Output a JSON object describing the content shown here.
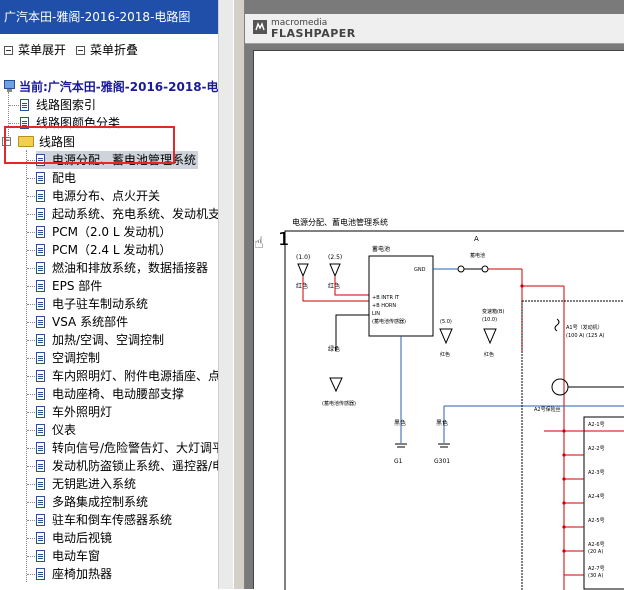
{
  "left_pane": {
    "title": "广汽本田-雅阁-2016-2018-电路图",
    "toolbar": {
      "expand": "菜单展开",
      "collapse": "菜单折叠"
    },
    "root_label": "当前:广汽本田-雅阁-2016-2018-电路图",
    "top_items": [
      "线路图索引",
      "线路图颜色分类"
    ],
    "folder_label": "线路图",
    "children": [
      "电源分配、蓄电池管理系统",
      "配电",
      "电源分布、点火开关",
      "起动系统、充电系统、发动机支座",
      "PCM（2.0 L 发动机）",
      "PCM（2.4 L 发动机）",
      "燃油和排放系统，数据插接器",
      "EPS 部件",
      "电子驻车制动系统",
      "VSA 系统部件",
      "加热/空调、空调控制",
      "空调控制",
      "车内照明灯、附件电源插座、点烟",
      "电动座椅、电动腰部支撑",
      "车外照明灯",
      "仪表",
      "转向信号/危险警告灯、大灯调平",
      "发动机防盗锁止系统、遥控器/电",
      "无钥匙进入系统",
      "多路集成控制系统",
      "驻车和倒车传感器系统",
      "电动后视镜",
      "电动车窗",
      "座椅加热器"
    ]
  },
  "viewer": {
    "brand_small": "macromedia",
    "brand_big": "FLASHPAPER",
    "page_number": "1",
    "diagram_title": "电源分配、蓄电池管理系统",
    "labels": {
      "A": "A",
      "gnd": "GND",
      "battery": "蓄电池",
      "relay1": "(1.0)",
      "relay2": "(2.5)",
      "red1": "红色",
      "red2": "红色",
      "intr": "+B INTR IT",
      "horn": "+B HORN",
      "lin": "LIN",
      "lin_sub": "(蓄电池传感器)",
      "green": "绿色",
      "black1": "黑色",
      "black2": "黑色",
      "g1": "G1",
      "g301": "G301",
      "p5": "(5.0)",
      "p10": "(10.0)",
      "red3": "红色",
      "mid_label": "变速箱(B)",
      "mid_sub": "(10.0)",
      "a1": "A1号（发动机）",
      "a1_val": "(100 A) (125 A)",
      "a2": "A2号保险丝",
      "a21": "A2-1号",
      "a22": "A2-2号",
      "a23": "A2-3号",
      "a24": "A2-4号",
      "a25": "A2-5号",
      "a26": "A2-6号",
      "a26_val": "(20 A)",
      "a27": "A2-7号",
      "a27_val": "(30 A)"
    }
  }
}
